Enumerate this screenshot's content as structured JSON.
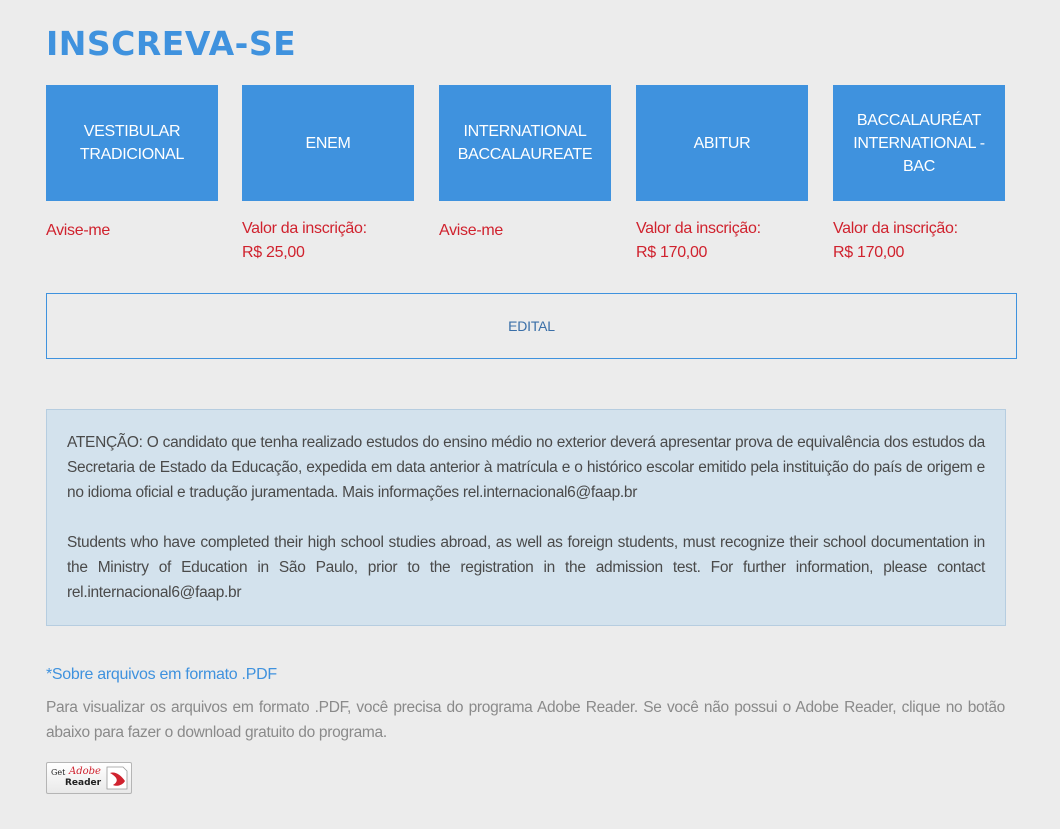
{
  "page": {
    "title": "INSCREVA-SE"
  },
  "exams": [
    {
      "name": "VESTIBULAR TRADICIONAL",
      "fee_label": "",
      "fee_value": "",
      "notify_label": "Avise-me"
    },
    {
      "name": "ENEM",
      "fee_label": "Valor da inscrição:",
      "fee_value": "R$ 25,00",
      "notify_label": ""
    },
    {
      "name": "INTERNATIONAL BACCALAUREATE",
      "fee_label": "",
      "fee_value": "",
      "notify_label": "Avise-me"
    },
    {
      "name": "ABITUR",
      "fee_label": "Valor da inscrição:",
      "fee_value": "R$ 170,00",
      "notify_label": ""
    },
    {
      "name": "BACCALAURÉAT INTERNATIONAL - BAC",
      "fee_label": "Valor da inscrição:",
      "fee_value": "R$ 170,00",
      "notify_label": ""
    }
  ],
  "edital": {
    "label": "EDITAL"
  },
  "notice": {
    "pt": "ATENÇÃO: O candidato que tenha realizado estudos do ensino médio no exterior deverá apresentar prova de equivalência dos estudos da Secretaria de Estado da Educação, expedida em data anterior à matrícula e o histórico escolar emitido pela instituição do país de origem e no idioma oficial e tradução juramentada. Mais informações rel.internacional6@faap.br",
    "en": "Students who have completed their high school studies abroad, as well as foreign students, must recognize their school documentation in the Ministry of Education in São Paulo, prior to the registration in the admission test. For further information, please contact rel.internacional6@faap.br"
  },
  "pdf_info": {
    "title": "*Sobre arquivos em formato .PDF",
    "text": "Para visualizar os arquivos em formato .PDF, você precisa do programa Adobe Reader. Se você não possui o Adobe Reader, clique no botão abaixo para fazer o download gratuito do programa."
  },
  "adobe_badge": {
    "get": "Get",
    "brand": "Adobe",
    "product": "Reader"
  },
  "colors": {
    "accent": "#3f92de",
    "fee_text": "#d0222e",
    "notice_bg": "#d3e2ed",
    "background": "#ececec"
  }
}
